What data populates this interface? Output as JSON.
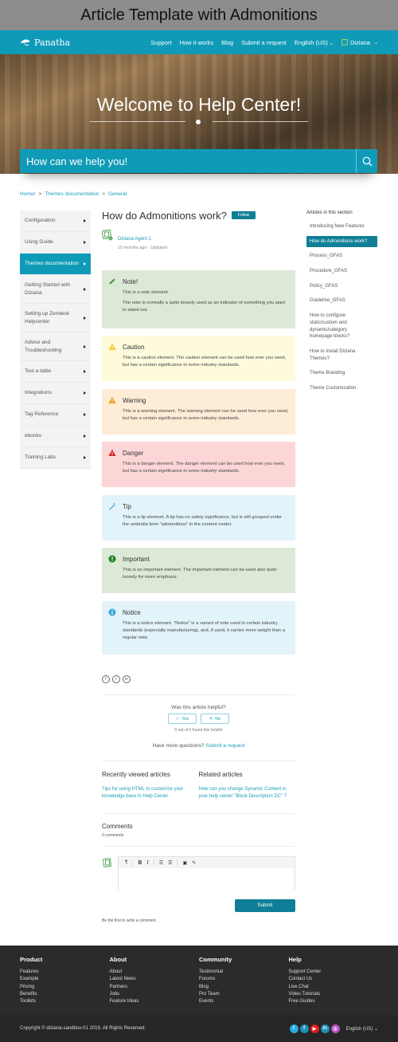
{
  "caption": "Article Template with Admonitions",
  "navbar": {
    "logo_text": "Panatha",
    "links": [
      "Support",
      "How it works",
      "Blog",
      "Submit a request"
    ],
    "language": "English (US)",
    "user": "Diziana"
  },
  "hero": {
    "title": "Welcome to Help Center!",
    "search_placeholder": "How can we help you!"
  },
  "breadcrumb": [
    "Homer",
    "Themes documentation",
    "General"
  ],
  "sidebar": {
    "items": [
      {
        "label": "Configuration",
        "active": false
      },
      {
        "label": "Using Guide",
        "active": false
      },
      {
        "label": "Themes documentation",
        "active": true
      },
      {
        "label": "Getting Started with Diziana",
        "active": false
      },
      {
        "label": "Setting up Zendesk Helpcenter",
        "active": false
      },
      {
        "label": "Advice and Troubleshooting",
        "active": false
      },
      {
        "label": "Test a table",
        "active": false
      },
      {
        "label": "Integrations",
        "active": false
      },
      {
        "label": "Tag Reference",
        "active": false
      },
      {
        "label": "ebooks",
        "active": false
      },
      {
        "label": "Training Labs",
        "active": false
      }
    ]
  },
  "article": {
    "title": "How do Admonitions work?",
    "follow_label": "Follow",
    "author": "Diziana Agent 1",
    "time": "10 months ago",
    "updated": "Updated",
    "admonitions": [
      {
        "type": "note",
        "title": "Note!",
        "paragraphs": [
          "This is a note element.",
          "The note is normally a quite loosely used as an indicator of something you want to stand out."
        ],
        "bg": "#dce9d6",
        "icon_color": "#3c9a2e"
      },
      {
        "type": "caution",
        "title": "Caution",
        "paragraphs": [
          "This is a caution element. The caution element can be used how ever you need, but has a certain significance in some industry standards."
        ],
        "bg": "#fdfbdc",
        "icon_color": "#f2cb2c"
      },
      {
        "type": "warning",
        "title": "Warning",
        "paragraphs": [
          "This is a warning element. The warning element can be used how ever you need, but has a certain significance in some industry standards."
        ],
        "bg": "#fdecd6",
        "icon_color": "#f29a18"
      },
      {
        "type": "danger",
        "title": "Danger",
        "paragraphs": [
          "This is a danger element. The danger element can be used how ever you need, but has a certain significance in some industry standards."
        ],
        "bg": "#fcd6d6",
        "icon_color": "#d11d1d"
      },
      {
        "type": "tip",
        "title": "Tip",
        "paragraphs": [
          "This is a tip element. A tip has no safety significance, but is still grouped under the umbrella term \"admonitions\" in the content model."
        ],
        "bg": "#e3f3fa",
        "icon_color": "#4bb3d9"
      },
      {
        "type": "important",
        "title": "Important",
        "paragraphs": [
          "This is an important element. The important element can be used also quite loosely for more emphasis."
        ],
        "bg": "#dce9d6",
        "icon_color": "#1f7d1f"
      },
      {
        "type": "notice",
        "title": "Notice",
        "paragraphs": [
          "This is a notice element. \"Notice\" is a variant of note used in certain industry standards (especially manufacturing), and, if used, it carries more weight than a regular note."
        ],
        "bg": "#e3f3fa",
        "icon_color": "#3aa7d6"
      }
    ],
    "share_icons": [
      "facebook-icon",
      "twitter-icon",
      "linkedin-icon"
    ],
    "helpful": {
      "question": "Was this article helpful?",
      "yes": "Yes",
      "no": "No",
      "count": "0 out of 0 found this helpful"
    },
    "more_questions": "Have more questions?",
    "submit_request": "Submit a request",
    "recently_viewed": {
      "title": "Recently viewed articles",
      "links": [
        "Tips for using HTML to customize your knowledge base in Help Center"
      ]
    },
    "related": {
      "title": "Related articles",
      "links": [
        "How can you change Dynamic Content in your help center \"Block Description DC\" ?"
      ]
    },
    "comments": {
      "title": "Comments",
      "count": "0 comments",
      "submit": "Submit",
      "first": "Be the first to write a comment."
    }
  },
  "section_articles": {
    "title": "Articles in this section",
    "items": [
      {
        "label": "Introducing New Features",
        "active": false
      },
      {
        "label": "How do Admonitions work?",
        "active": true
      },
      {
        "label": "Process_GFAS",
        "active": false
      },
      {
        "label": "Procedure_GFAS",
        "active": false
      },
      {
        "label": "Policy_GFAS",
        "active": false
      },
      {
        "label": "Guideline_GFAS",
        "active": false
      },
      {
        "label": "How to configure static/custom and dynamic/category homepage blocks?",
        "active": false
      },
      {
        "label": "How to install Diziana Themes?",
        "active": false
      },
      {
        "label": "Theme Branding",
        "active": false
      },
      {
        "label": "Theme Customization",
        "active": false
      }
    ]
  },
  "footer": {
    "columns": [
      {
        "title": "Product",
        "links": [
          "Features",
          "Example",
          "Pricing",
          "Benefits",
          "Toolkits"
        ]
      },
      {
        "title": "About",
        "links": [
          "About",
          "Latest News",
          "Partners",
          "Jobs",
          "Feature Ideas"
        ]
      },
      {
        "title": "Community",
        "links": [
          "Testimonial",
          "Forums",
          "Blog",
          "Pro Team",
          "Events"
        ]
      },
      {
        "title": "Help",
        "links": [
          "Support Center",
          "Contact Us",
          "Live Chat",
          "Video Tutorials",
          "Free Guides"
        ]
      }
    ],
    "copyright": "Copyright © diziana-sandbox-01 2019. All Rights Reserved.",
    "social": [
      {
        "name": "twitter-icon",
        "glyph": "t",
        "color": "#2aa9e0"
      },
      {
        "name": "facebook-icon",
        "glyph": "f",
        "color": "#1f8fb5"
      },
      {
        "name": "youtube-icon",
        "glyph": "▶",
        "color": "#e01e1e"
      },
      {
        "name": "linkedin-icon",
        "glyph": "in",
        "color": "#1f8fb5"
      },
      {
        "name": "instagram-icon",
        "glyph": "◎",
        "color": "#b94fc8"
      }
    ],
    "language": "English (US)"
  }
}
